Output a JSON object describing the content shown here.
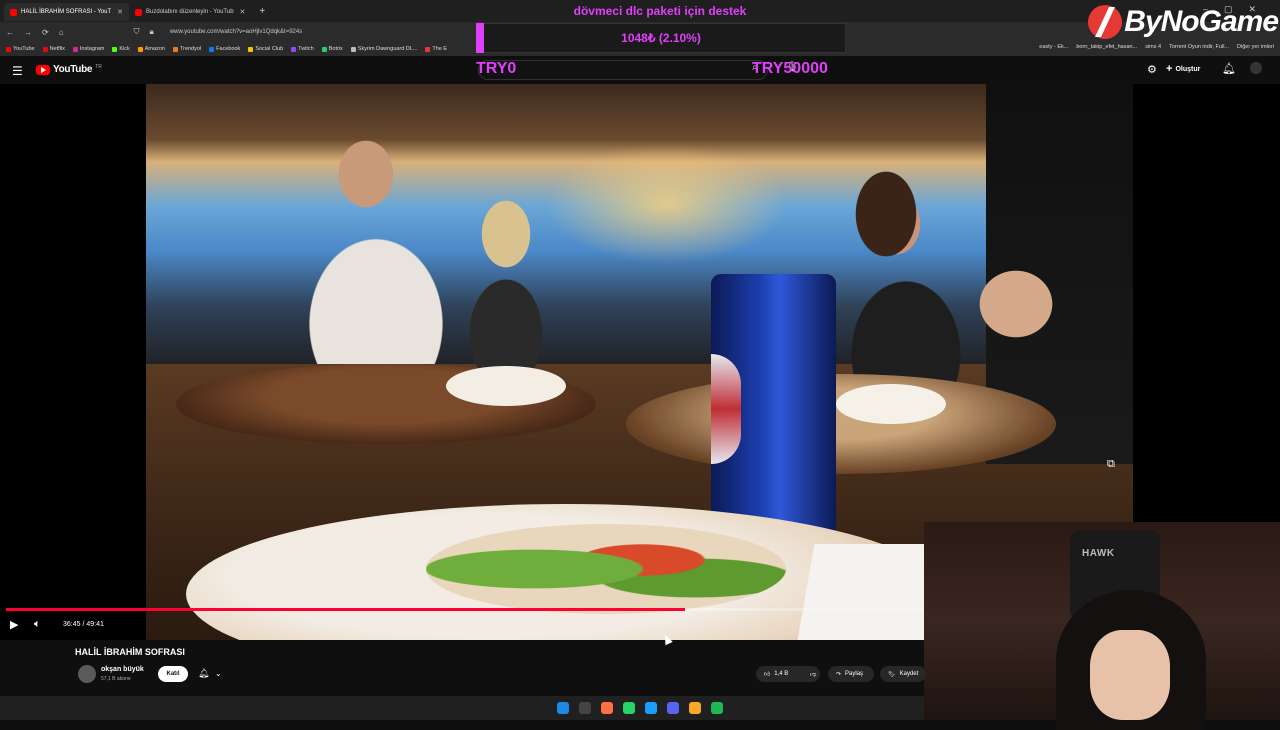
{
  "browser": {
    "tabs": [
      {
        "label": "HALİL İBRAHİM SOFRASI - YouT",
        "active": true
      },
      {
        "label": "Buzdolabını düzenleyin - YouTub",
        "active": false
      }
    ],
    "url": "www.youtube.com/watch?v=aoHjlv1Qdqk&t=924s",
    "bookmarks": [
      "YouTube",
      "Netflix",
      "Instagram",
      "Kick",
      "Amazon",
      "Trendyol",
      "Facebook",
      "Social Club",
      "Twitch",
      "Botrix",
      "Skyrim Dawnguard DL...",
      "The E"
    ],
    "bookmarks_right": [
      "easty - Ek...",
      "borrı_takip_efet_hasan...",
      "sims 4",
      "Torrent Oyun indir, Full...",
      "Diğer yer imleri"
    ]
  },
  "overlay": {
    "donation_title": "dövmeci dlc paketi için destek",
    "donation_amount": "1048₺ (2.10%)",
    "donation_progress": 0.021,
    "donation_min": "TRY0",
    "donation_max": "TRY50000",
    "logo": "ByNoGame"
  },
  "youtube": {
    "logo_text": "YouTube",
    "logo_sup": "TR",
    "create_label": "Oluştur"
  },
  "player": {
    "time": "36:45 / 49:41",
    "progress": 0.7398
  },
  "video": {
    "title": "HALİL İBRAHİM SOFRASI",
    "channel": "okşan büyük",
    "subscribers": "57,1 B abone",
    "join_label": "Katıl",
    "like_count": "1,4 B",
    "share_label": "Paylaş",
    "save_label": "Kaydet"
  },
  "webcam": {
    "chair_logo": "HAWK"
  },
  "colors": {
    "accent_overlay": "#e040fb",
    "youtube_red": "#ff0000",
    "progress_red": "#ff0033"
  }
}
